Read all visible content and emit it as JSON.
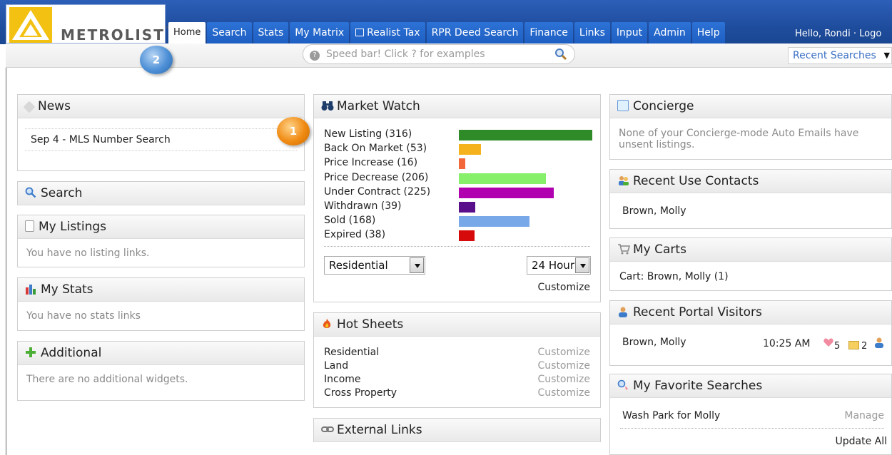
{
  "logo": {
    "text": "METROLIST",
    "tm": "™"
  },
  "tabs": [
    "Home",
    "Search",
    "Stats",
    "My Matrix",
    "Realist Tax",
    "RPR Deed Search",
    "Finance",
    "Links",
    "Input",
    "Admin",
    "Help"
  ],
  "user": {
    "greeting": "Hello, Rondi · Logo"
  },
  "speedbar": {
    "placeholder": "Speed bar! Click ? for examples"
  },
  "recent_searches": {
    "label": "Recent Searches"
  },
  "callouts": {
    "one": "1",
    "two": "2"
  },
  "news": {
    "title": "News",
    "item": "Sep 4 - MLS Number Search"
  },
  "search": {
    "title": "Search"
  },
  "my_listings": {
    "title": "My Listings",
    "msg": "You have no listing links."
  },
  "my_stats": {
    "title": "My Stats",
    "msg": "You have no stats links"
  },
  "additional": {
    "title": "Additional",
    "msg": "There are no additional widgets."
  },
  "market_watch": {
    "title": "Market Watch",
    "rows": [
      {
        "label": "New Listing (316)",
        "value": 316,
        "color": "#2e8b27"
      },
      {
        "label": "Back On Market (53)",
        "value": 53,
        "color": "#f5b21c"
      },
      {
        "label": "Price Increase (16)",
        "value": 16,
        "color": "#f2683a"
      },
      {
        "label": "Price Decrease (206)",
        "value": 206,
        "color": "#86f06a"
      },
      {
        "label": "Under Contract (225)",
        "value": 225,
        "color": "#b000b0"
      },
      {
        "label": "Withdrawn (39)",
        "value": 39,
        "color": "#5a0f8a"
      },
      {
        "label": "Sold (168)",
        "value": 168,
        "color": "#78a8e8"
      },
      {
        "label": "Expired (38)",
        "value": 38,
        "color": "#d60a0a"
      }
    ],
    "property_type": "Residential",
    "period": "24 Hour",
    "customize": "Customize"
  },
  "hot_sheets": {
    "title": "Hot Sheets",
    "rows": [
      {
        "label": "Residential",
        "action": "Customize"
      },
      {
        "label": "Land",
        "action": "Customize"
      },
      {
        "label": "Income",
        "action": "Customize"
      },
      {
        "label": "Cross Property",
        "action": "Customize"
      }
    ]
  },
  "external_links": {
    "title": "External Links"
  },
  "concierge": {
    "title": "Concierge",
    "msg": "None of your Concierge-mode Auto Emails have unsent listings."
  },
  "recent_contacts": {
    "title": "Recent Use Contacts",
    "item": "Brown, Molly"
  },
  "my_carts": {
    "title": "My Carts",
    "item": "Cart: Brown, Molly (1)"
  },
  "portal_visitors": {
    "title": "Recent Portal Visitors",
    "name": "Brown, Molly",
    "time": "10:25 AM",
    "favorites": "5",
    "mail": "2"
  },
  "favorite_searches": {
    "title": "My Favorite Searches",
    "item": "Wash Park for Molly",
    "manage": "Manage",
    "update": "Update All"
  }
}
